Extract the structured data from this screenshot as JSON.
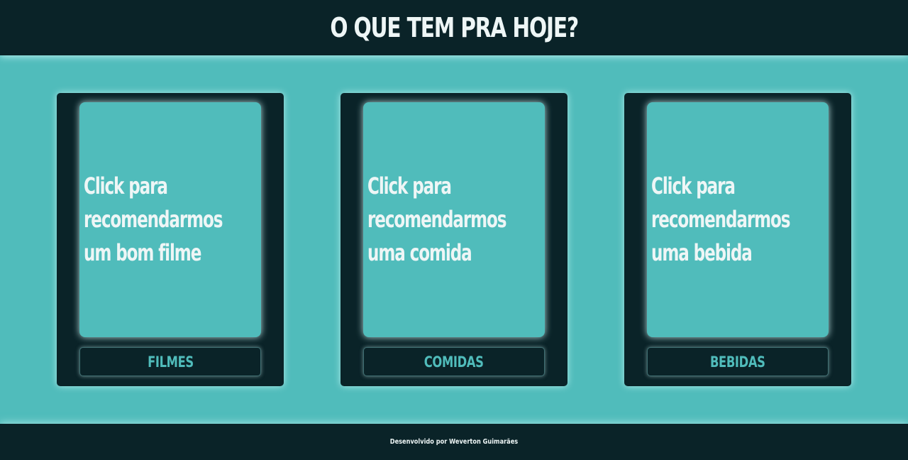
{
  "header": {
    "title": "O QUE TEM PRA HOJE?"
  },
  "cards": [
    {
      "text_lines": [
        "Click para",
        "recomendarmos",
        "um bom filme"
      ],
      "button_label": "FILMES"
    },
    {
      "text_lines": [
        "Click para",
        "recomendarmos",
        "uma comida"
      ],
      "button_label": "COMIDAS"
    },
    {
      "text_lines": [
        "Click para",
        "recomendarmos",
        "uma bebida"
      ],
      "button_label": "BEBIDAS"
    }
  ],
  "footer": {
    "text": "Desenvolvido por Weverton Guimarães"
  },
  "colors": {
    "dark": "#0a2328",
    "accent": "#50bcbb",
    "text": "#eef6f6"
  }
}
